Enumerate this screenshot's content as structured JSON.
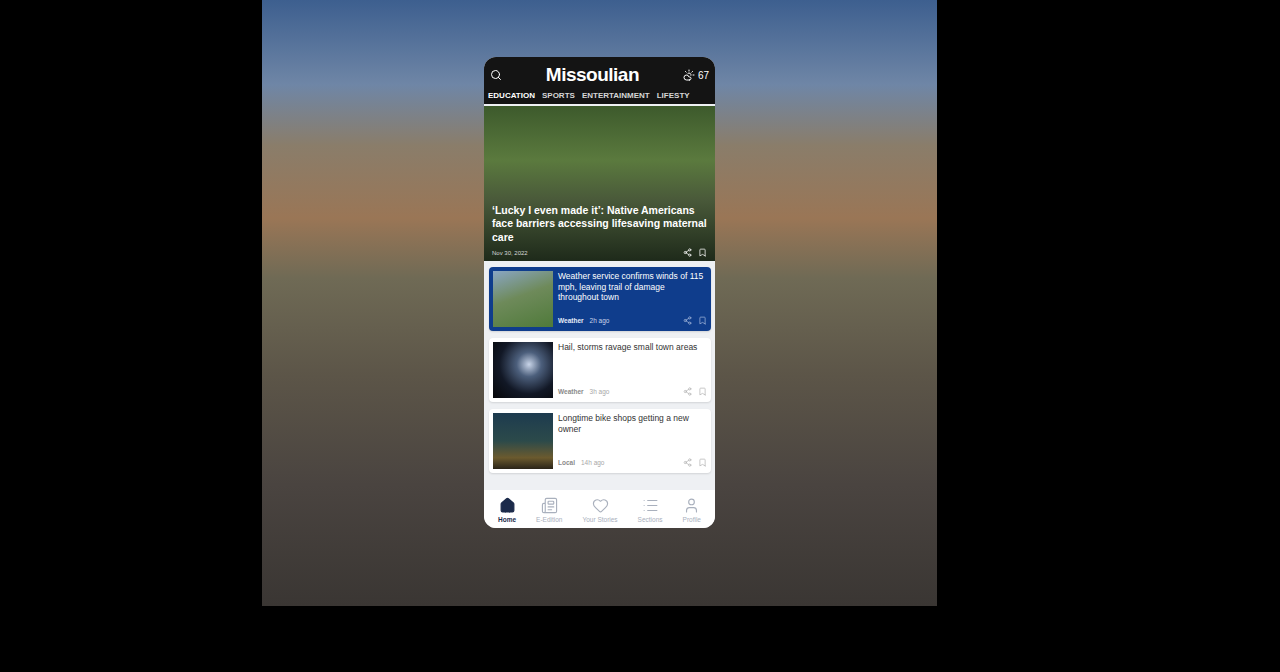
{
  "header": {
    "logo": "Missoulian",
    "temperature": "67"
  },
  "nav": [
    {
      "label": "EDUCATION",
      "selected": true
    },
    {
      "label": "SPORTS",
      "selected": false
    },
    {
      "label": "ENTERTAINMENT",
      "selected": false
    },
    {
      "label": "LIFESTY",
      "selected": false
    }
  ],
  "hero": {
    "headline": "‘Lucky I even made it’: Native Americans face barriers accessing lifesaving maternal care",
    "date": "Nov 30, 2022"
  },
  "stories": [
    {
      "title": "Weather service confirms winds of 115 mph, leaving trail of damage throughout town",
      "category": "Weather",
      "time": "2h ago",
      "selected": true
    },
    {
      "title": "Hail, storms ravage small town areas",
      "category": "Weather",
      "time": "3h ago",
      "selected": false
    },
    {
      "title": "Longtime bike shops getting a new owner",
      "category": "Local",
      "time": "14h ago",
      "selected": false
    }
  ],
  "tabbar": [
    {
      "label": "Home",
      "selected": true
    },
    {
      "label": "E-Edition",
      "selected": false
    },
    {
      "label": "Your Stories",
      "selected": false
    },
    {
      "label": "Sections",
      "selected": false
    },
    {
      "label": "Profile",
      "selected": false
    }
  ]
}
